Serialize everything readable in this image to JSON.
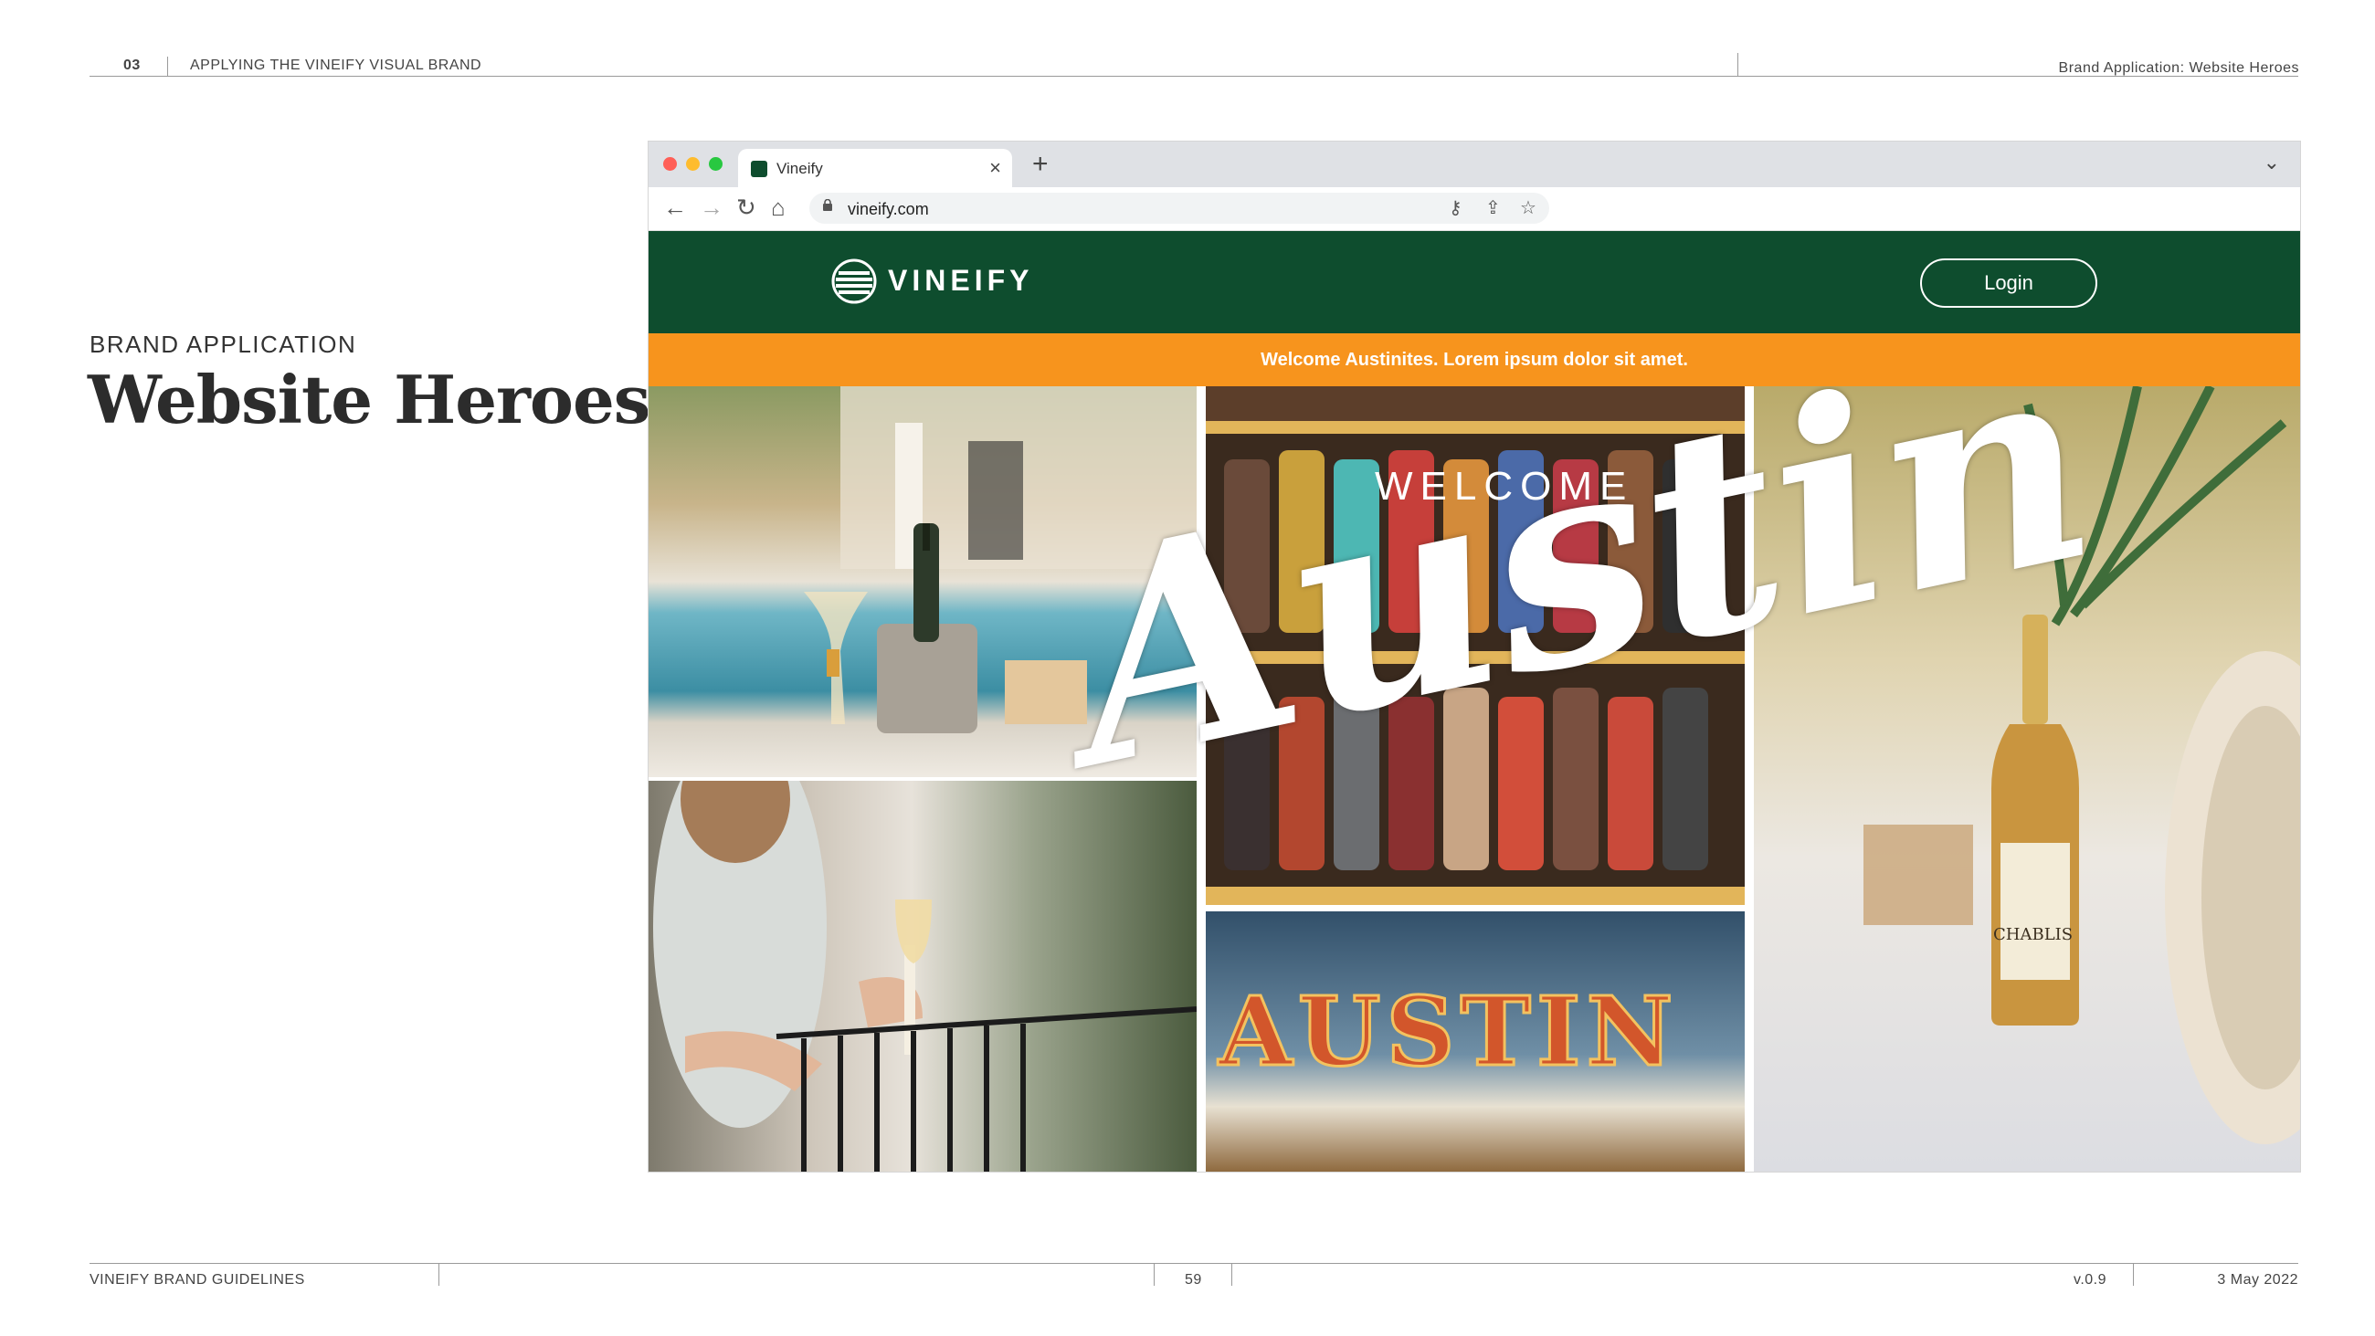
{
  "header": {
    "section_number": "03",
    "section_title": "APPLYING THE VINEIFY VISUAL BRAND",
    "page_topic": "Brand Application: Website Heroes"
  },
  "main": {
    "eyebrow": "BRAND APPLICATION",
    "title": "Website Heroes"
  },
  "browser": {
    "tab_title": "Vineify",
    "url": "vineify.com",
    "tab_close": "×",
    "new_tab": "+",
    "tabs_menu": "⌄",
    "nav_back": "←",
    "nav_forward": "→",
    "nav_reload": "↻",
    "nav_home": "⌂",
    "key_icon": "⚷",
    "share_icon": "⇪",
    "bookmark_icon": "☆"
  },
  "site": {
    "logo_text": "VINEIFY",
    "login_label": "Login",
    "banner_text": "Welcome Austinites. Lorem ipsum dolor sit amet.",
    "hero_welcome": "WELCOME",
    "hero_script": "Austin",
    "sign_text": "AUSTIN",
    "bottle_label": "CHABLIS",
    "brand_green": "#0e4d2e",
    "banner_orange": "#f7941d"
  },
  "footer": {
    "doc_title": "VINEIFY BRAND GUIDELINES",
    "page_number": "59",
    "version": "v.0.9",
    "date": "3 May 2022"
  }
}
